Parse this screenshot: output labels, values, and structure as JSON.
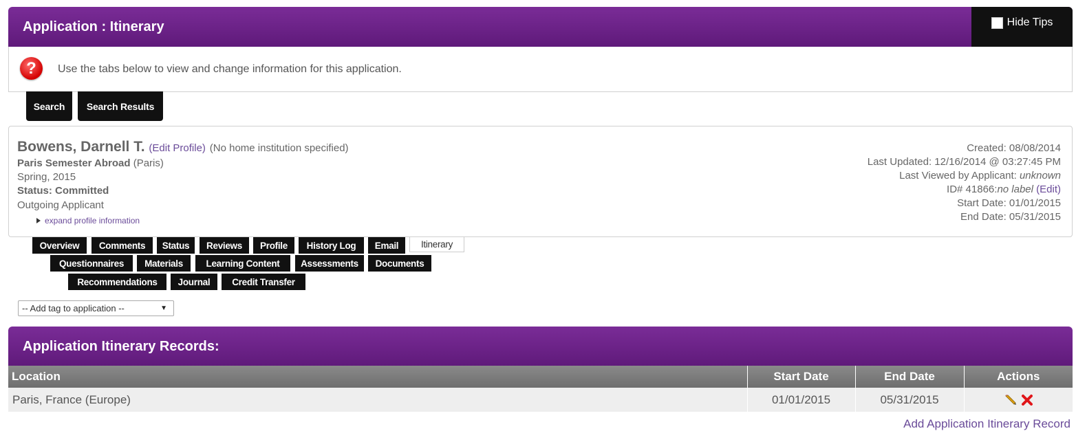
{
  "header": {
    "title": "Application : Itinerary",
    "hide_tips": "Hide Tips"
  },
  "tip": {
    "text": "Use the tabs below to view and change information for this application.",
    "icon": "question-icon"
  },
  "nav_buttons": {
    "search": "Search",
    "search_results": "Search Results"
  },
  "profile": {
    "name": "Bowens, Darnell T.",
    "edit_profile": "(Edit Profile)",
    "home_institution": "(No home institution specified)",
    "program": "Paris Semester Abroad",
    "program_location": "(Paris)",
    "term": "Spring, 2015",
    "status": "Status: Committed",
    "applicant_type": "Outgoing Applicant",
    "expand": "expand profile information",
    "created": "Created: 08/08/2014",
    "last_updated": "Last Updated: 12/16/2014 @ 03:27:45 PM",
    "last_viewed_label": "Last Viewed by Applicant:",
    "last_viewed_value": "unknown",
    "id_label": "ID# 41866:",
    "id_value": "no label",
    "id_edit": "(Edit)",
    "start_date": "Start Date: 01/01/2015",
    "end_date": "End Date: 05/31/2015"
  },
  "tabs": {
    "row1": [
      "Overview",
      "Comments",
      "Status",
      "Reviews",
      "Profile",
      "History Log",
      "Email",
      "Itinerary"
    ],
    "row2": [
      "Questionnaires",
      "Materials",
      "Learning Content",
      "Assessments",
      "Documents"
    ],
    "row3": [
      "Recommendations",
      "Journal",
      "Credit Transfer"
    ],
    "active": "Itinerary"
  },
  "tag_select": {
    "selected": "-- Add tag to application --"
  },
  "itinerary": {
    "title": "Application Itinerary Records:",
    "columns": [
      "Location",
      "Start Date",
      "End Date",
      "Actions"
    ],
    "rows": [
      {
        "location": "Paris, France (Europe)",
        "start": "01/01/2015",
        "end": "05/31/2015"
      }
    ],
    "add_link": "Add Application Itinerary Record"
  }
}
